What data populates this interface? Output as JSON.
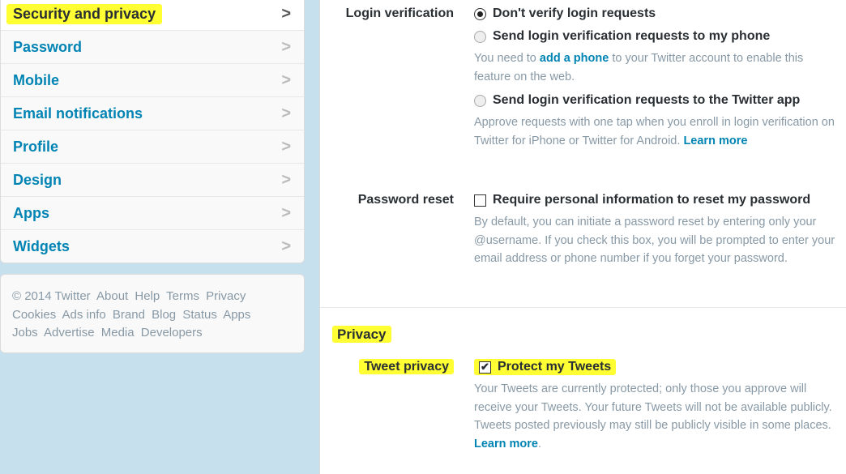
{
  "sidebar": {
    "items": [
      {
        "label": "Security and privacy",
        "active": true
      },
      {
        "label": "Password"
      },
      {
        "label": "Mobile"
      },
      {
        "label": "Email notifications"
      },
      {
        "label": "Profile"
      },
      {
        "label": "Design"
      },
      {
        "label": "Apps"
      },
      {
        "label": "Widgets"
      }
    ]
  },
  "footer": {
    "links": [
      "© 2014 Twitter",
      "About",
      "Help",
      "Terms",
      "Privacy",
      "Cookies",
      "Ads info",
      "Brand",
      "Blog",
      "Status",
      "Apps",
      "Jobs",
      "Advertise",
      "Media",
      "Developers"
    ]
  },
  "login": {
    "label": "Login verification",
    "opt1": "Don't verify login requests",
    "opt2": "Send login verification requests to my phone",
    "help2_a": "You need to ",
    "help2_link": "add a phone",
    "help2_b": " to your Twitter account to enable this feature on the web.",
    "opt3": "Send login verification requests to the Twitter app",
    "help3": "Approve requests with one tap when you enroll in login verification on Twitter for iPhone or Twitter for Android. ",
    "help3_link": "Learn more"
  },
  "reset": {
    "label": "Password reset",
    "option": "Require personal information to reset my password",
    "help": "By default, you can initiate a password reset by entering only your @username. If you check this box, you will be prompted to enter your email address or phone number if you forget your password."
  },
  "privacy": {
    "title": "Privacy",
    "label": "Tweet privacy",
    "option": "Protect my Tweets",
    "checked": true,
    "help": "Your Tweets are currently protected; only those you approve will receive your Tweets. Your future Tweets will not be available publicly. Tweets posted previously may still be publicly visible in some places. ",
    "help_link": "Learn more",
    "help_end": "."
  },
  "colors": {
    "link": "#0084b4",
    "highlight": "#ffff33",
    "background": "#c6e0ee"
  }
}
